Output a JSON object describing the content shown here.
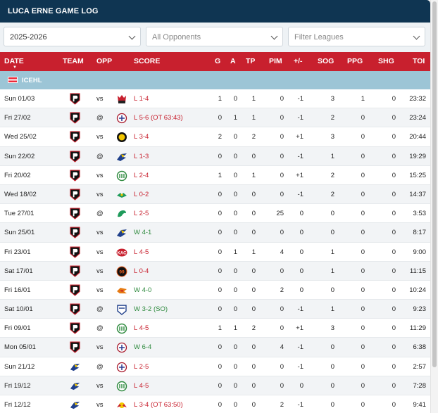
{
  "title": "LUCA ERNE GAME LOG",
  "filters": {
    "season": "2025-2026",
    "opponents": "All Opponents",
    "leagues_placeholder": "Filter Leagues"
  },
  "columns": [
    "DATE",
    "TEAM",
    "OPP",
    "SCORE",
    "G",
    "A",
    "TP",
    "PIM",
    "+/-",
    "SOG",
    "PPG",
    "SHG",
    "TOI"
  ],
  "sort_indicator": "▼",
  "league": {
    "name": "ICEHL",
    "flag": "austria-flag"
  },
  "colors": {
    "header": "#c8202e",
    "title": "#0f3552",
    "league_band": "#9cc5d6",
    "loss": "#c8202e",
    "win": "#2e8a3e"
  },
  "rows": [
    {
      "date": "Sun 01/03",
      "team": "pioneers",
      "ha": "vs",
      "opp": "red-mascot-icon",
      "res": "L",
      "score": "1-4",
      "extra": "",
      "g": "1",
      "a": "0",
      "tp": "1",
      "pim": "0",
      "pm": "-1",
      "sog": "3",
      "ppg": "1",
      "shg": "0",
      "toi": "23:32"
    },
    {
      "date": "Fri 27/02",
      "team": "pioneers",
      "ha": "@",
      "opp": "caps-icon",
      "res": "L",
      "score": "5-6",
      "extra": "(OT 63:43)",
      "g": "0",
      "a": "1",
      "tp": "1",
      "pim": "0",
      "pm": "-1",
      "sog": "2",
      "ppg": "0",
      "shg": "0",
      "toi": "23:24"
    },
    {
      "date": "Wed 25/02",
      "team": "pioneers",
      "ha": "vs",
      "opp": "yellow-black-icon",
      "res": "L",
      "score": "3-4",
      "extra": "",
      "g": "2",
      "a": "0",
      "tp": "2",
      "pim": "0",
      "pm": "+1",
      "sog": "3",
      "ppg": "0",
      "shg": "0",
      "toi": "20:44"
    },
    {
      "date": "Sun 22/02",
      "team": "pioneers",
      "ha": "@",
      "opp": "eagle-icon",
      "res": "L",
      "score": "1-3",
      "extra": "",
      "g": "0",
      "a": "0",
      "tp": "0",
      "pim": "0",
      "pm": "-1",
      "sog": "1",
      "ppg": "0",
      "shg": "0",
      "toi": "19:29"
    },
    {
      "date": "Fri 20/02",
      "team": "pioneers",
      "ha": "vs",
      "opp": "green-crest-icon",
      "res": "L",
      "score": "2-4",
      "extra": "",
      "g": "1",
      "a": "0",
      "tp": "1",
      "pim": "0",
      "pm": "+1",
      "sog": "2",
      "ppg": "0",
      "shg": "0",
      "toi": "15:25"
    },
    {
      "date": "Wed 18/02",
      "team": "pioneers",
      "ha": "vs",
      "opp": "green-wing-icon",
      "res": "L",
      "score": "0-2",
      "extra": "",
      "g": "0",
      "a": "0",
      "tp": "0",
      "pim": "0",
      "pm": "-1",
      "sog": "2",
      "ppg": "0",
      "shg": "0",
      "toi": "14:37"
    },
    {
      "date": "Tue 27/01",
      "team": "pioneers",
      "ha": "@",
      "opp": "green-dragon-icon",
      "res": "L",
      "score": "2-5",
      "extra": "",
      "g": "0",
      "a": "0",
      "tp": "0",
      "pim": "25",
      "pm": "0",
      "sog": "0",
      "ppg": "0",
      "shg": "0",
      "toi": "3:53"
    },
    {
      "date": "Sun 25/01",
      "team": "pioneers",
      "ha": "vs",
      "opp": "eagle-icon",
      "res": "W",
      "score": "4-1",
      "extra": "",
      "g": "0",
      "a": "0",
      "tp": "0",
      "pim": "0",
      "pm": "0",
      "sog": "0",
      "ppg": "0",
      "shg": "0",
      "toi": "8:17"
    },
    {
      "date": "Fri 23/01",
      "team": "pioneers",
      "ha": "vs",
      "opp": "kac-icon",
      "res": "L",
      "score": "4-5",
      "extra": "",
      "g": "0",
      "a": "1",
      "tp": "1",
      "pim": "4",
      "pm": "0",
      "sog": "1",
      "ppg": "0",
      "shg": "0",
      "toi": "9:00"
    },
    {
      "date": "Sat 17/01",
      "team": "pioneers",
      "ha": "vs",
      "opp": "99ers-icon",
      "res": "L",
      "score": "0-4",
      "extra": "",
      "g": "0",
      "a": "0",
      "tp": "0",
      "pim": "0",
      "pm": "0",
      "sog": "1",
      "ppg": "0",
      "shg": "0",
      "toi": "11:15"
    },
    {
      "date": "Fri 16/01",
      "team": "pioneers",
      "ha": "vs",
      "opp": "orange-icon",
      "res": "W",
      "score": "4-0",
      "extra": "",
      "g": "0",
      "a": "0",
      "tp": "0",
      "pim": "2",
      "pm": "0",
      "sog": "0",
      "ppg": "0",
      "shg": "0",
      "toi": "10:24"
    },
    {
      "date": "Sat 10/01",
      "team": "pioneers",
      "ha": "@",
      "opp": "blue-shield-icon",
      "res": "W",
      "score": "3-2",
      "extra": "(SO)",
      "g": "0",
      "a": "0",
      "tp": "0",
      "pim": "0",
      "pm": "-1",
      "sog": "1",
      "ppg": "0",
      "shg": "0",
      "toi": "9:23"
    },
    {
      "date": "Fri 09/01",
      "team": "pioneers",
      "ha": "@",
      "opp": "green-crest-icon",
      "res": "L",
      "score": "4-5",
      "extra": "",
      "g": "1",
      "a": "1",
      "tp": "2",
      "pim": "0",
      "pm": "+1",
      "sog": "3",
      "ppg": "0",
      "shg": "0",
      "toi": "11:29"
    },
    {
      "date": "Mon 05/01",
      "team": "pioneers",
      "ha": "vs",
      "opp": "caps-icon",
      "res": "W",
      "score": "6-4",
      "extra": "",
      "g": "0",
      "a": "0",
      "tp": "0",
      "pim": "4",
      "pm": "-1",
      "sog": "0",
      "ppg": "0",
      "shg": "0",
      "toi": "6:38"
    },
    {
      "date": "Sun 21/12",
      "team": "eagle",
      "ha": "@",
      "opp": "caps-icon",
      "res": "L",
      "score": "2-5",
      "extra": "",
      "g": "0",
      "a": "0",
      "tp": "0",
      "pim": "0",
      "pm": "-1",
      "sog": "0",
      "ppg": "0",
      "shg": "0",
      "toi": "2:57"
    },
    {
      "date": "Fri 19/12",
      "team": "eagle",
      "ha": "vs",
      "opp": "green-crest-icon",
      "res": "L",
      "score": "4-5",
      "extra": "",
      "g": "0",
      "a": "0",
      "tp": "0",
      "pim": "0",
      "pm": "0",
      "sog": "0",
      "ppg": "0",
      "shg": "0",
      "toi": "7:28"
    },
    {
      "date": "Fri 12/12",
      "team": "eagle",
      "ha": "vs",
      "opp": "red-bull-icon",
      "res": "L",
      "score": "3-4",
      "extra": "(OT 63:50)",
      "g": "0",
      "a": "0",
      "tp": "0",
      "pim": "2",
      "pm": "-1",
      "sog": "0",
      "ppg": "0",
      "shg": "0",
      "toi": "9:41"
    }
  ]
}
